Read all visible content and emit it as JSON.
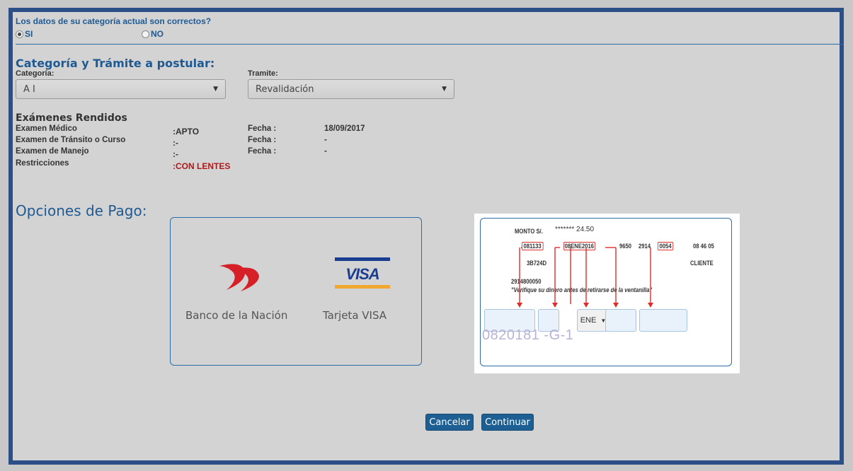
{
  "question": "Los datos de su categoría actual son correctos?",
  "radio": {
    "si": "SI",
    "no": "NO",
    "selected": "SI"
  },
  "section_title": "Categoría y Trámite a postular:",
  "categoria": {
    "label": "Categoría:",
    "value": "A I"
  },
  "tramite": {
    "label": "Tramite:",
    "value": "Revalidación"
  },
  "exams": {
    "title": "Exámenes Rendidos",
    "rows": [
      {
        "name": "Examen Médico",
        "result": ":APTO",
        "fecha_label": "Fecha :",
        "fecha": "18/09/2017"
      },
      {
        "name": "Examen de Tránsito o Curso",
        "result": ":-",
        "fecha_label": "Fecha :",
        "fecha": "-"
      },
      {
        "name": "Examen de Manejo",
        "result": ":-",
        "fecha_label": "Fecha :",
        "fecha": "-"
      },
      {
        "name": "Restricciones",
        "result": ":CON LENTES"
      }
    ]
  },
  "payment": {
    "title": "Opciones de Pago:",
    "options": [
      {
        "label": "Banco de la Nación"
      },
      {
        "label": "Tarjeta VISA"
      }
    ]
  },
  "receipt": {
    "monto_label": "MONTO S/.",
    "monto_value": "******* 24.50",
    "line1": [
      "081133",
      "08ENE2016",
      "9650",
      "2914",
      "0054",
      "08 46 05"
    ],
    "code": "3B724D",
    "cliente": "CLIENTE",
    "num": "2914800050",
    "note": "\"Verifique su dinero antes de retirarse de la ventanilla\"",
    "month_value": "ENE",
    "watermark": "0820181 -G-1"
  },
  "buttons": {
    "cancel": "Cancelar",
    "continue": "Continuar"
  },
  "colors": {
    "frame": "#2b4f86",
    "accent": "#1f5a93",
    "button": "#1d5f92",
    "restriction": "#b01818",
    "highlight": "#e02b2b"
  }
}
